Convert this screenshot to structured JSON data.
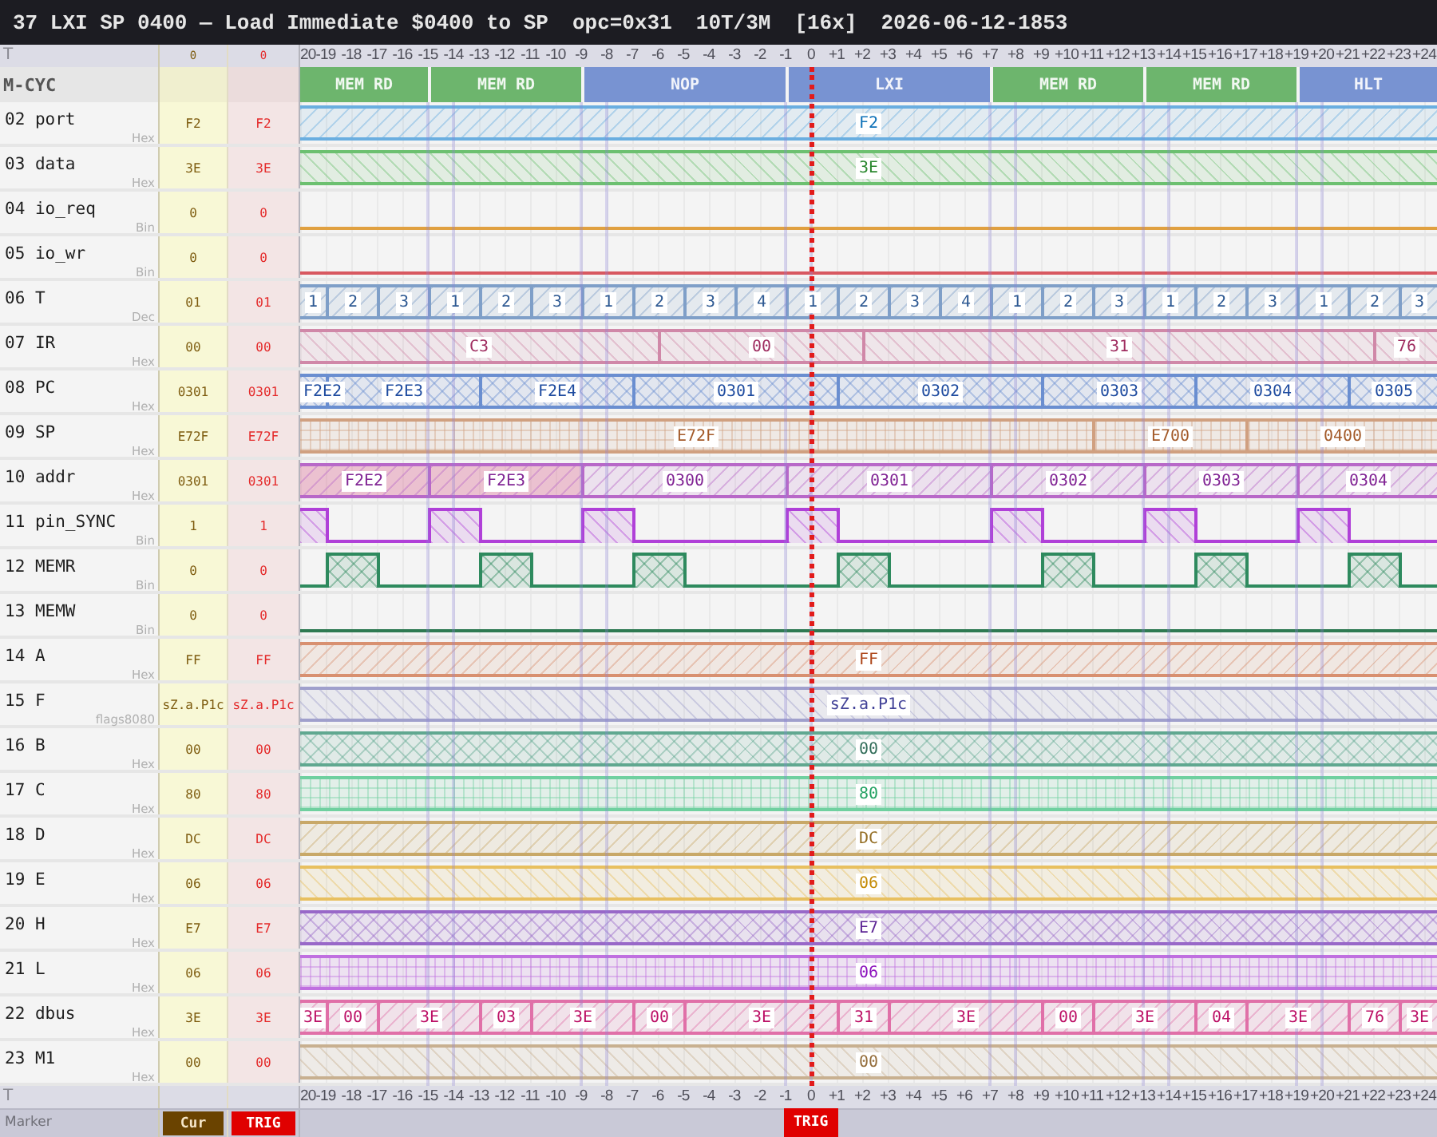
{
  "title_bar": {
    "parts": [
      "37 LXI SP 0400 — Load Immediate $0400 to SP",
      "opc=0x31",
      "10T/3M",
      "[16x]",
      "2026-06-12-1853"
    ]
  },
  "axis_top": {
    "label": "T",
    "cursor_value": "0",
    "trigger_value": "0",
    "ticks": [
      "20",
      "-19",
      "-18",
      "-17",
      "-16",
      "-15",
      "-14",
      "-13",
      "-12",
      "-11",
      "-10",
      "-9",
      "-8",
      "-7",
      "-6",
      "-5",
      "-4",
      "-3",
      "-2",
      "-1",
      "0",
      "+1",
      "+2",
      "+3",
      "+4",
      "+5",
      "+6",
      "+7",
      "+8",
      "+9",
      "+10",
      "+11",
      "+12",
      "+13",
      "+14",
      "+15",
      "+16",
      "+17",
      "+18",
      "+19",
      "+20",
      "+21",
      "+22",
      "+23",
      "+24"
    ]
  },
  "machine_cycles": {
    "label": "M-CYC",
    "cycles": [
      {
        "name": "MEM RD",
        "color": "#6db56d"
      },
      {
        "name": "MEM RD",
        "color": "#6db56d"
      },
      {
        "name": "NOP",
        "color": "#7893d2"
      },
      {
        "name": "LXI",
        "color": "#7893d2"
      },
      {
        "name": "MEM RD",
        "color": "#6db56d"
      },
      {
        "name": "MEM RD",
        "color": "#6db56d"
      },
      {
        "name": "HLT",
        "color": "#7893d2"
      }
    ]
  },
  "signals": [
    {
      "label": "02 port",
      "format": "Hex",
      "cursor_value": "F2",
      "trigger_value": "F2",
      "kind": "bus",
      "color": "#6aaee0",
      "segments": [
        {
          "value": "F2"
        }
      ]
    },
    {
      "label": "03 data",
      "format": "Hex",
      "cursor_value": "3E",
      "trigger_value": "3E",
      "kind": "bus",
      "color": "#6cc070",
      "segments": [
        {
          "value": "3E"
        }
      ]
    },
    {
      "label": "04 io_req",
      "format": "Bin",
      "cursor_value": "0",
      "trigger_value": "0",
      "kind": "bit",
      "color": "#e0a040",
      "segments": [
        {
          "high": false
        }
      ]
    },
    {
      "label": "05 io_wr",
      "format": "Bin",
      "cursor_value": "0",
      "trigger_value": "0",
      "kind": "bit",
      "color": "#d85860",
      "segments": [
        {
          "high": false
        }
      ]
    },
    {
      "label": "06 T",
      "format": "Dec",
      "cursor_value": "01",
      "trigger_value": "01",
      "kind": "bus",
      "color": "#7f9fc8",
      "segments": [
        {
          "value": "1"
        },
        {
          "value": "2"
        },
        {
          "value": "3"
        },
        {
          "value": "1"
        },
        {
          "value": "2"
        },
        {
          "value": "3"
        },
        {
          "value": "1"
        },
        {
          "value": "2"
        },
        {
          "value": "3"
        },
        {
          "value": "4"
        },
        {
          "value": "1"
        },
        {
          "value": "2"
        },
        {
          "value": "3"
        },
        {
          "value": "4"
        },
        {
          "value": "1"
        },
        {
          "value": "2"
        },
        {
          "value": "3"
        },
        {
          "value": "1"
        },
        {
          "value": "2"
        },
        {
          "value": "3"
        },
        {
          "value": "1"
        },
        {
          "value": "2"
        },
        {
          "value": "3"
        }
      ]
    },
    {
      "label": "07 IR",
      "format": "Hex",
      "cursor_value": "00",
      "trigger_value": "00",
      "kind": "bus",
      "color": "#d088a8",
      "segments": [
        {
          "value": "C3"
        },
        {
          "value": "00"
        },
        {
          "value": "31"
        },
        {
          "value": "76"
        }
      ]
    },
    {
      "label": "08 PC",
      "format": "Hex",
      "cursor_value": "0301",
      "trigger_value": "0301",
      "kind": "bus",
      "color": "#6a8ed0",
      "segments": [
        {
          "value": "F2E2"
        },
        {
          "value": "F2E3"
        },
        {
          "value": "F2E4"
        },
        {
          "value": "0301"
        },
        {
          "value": "0302"
        },
        {
          "value": "0303"
        },
        {
          "value": "0304"
        },
        {
          "value": "0305"
        }
      ]
    },
    {
      "label": "09 SP",
      "format": "Hex",
      "cursor_value": "E72F",
      "trigger_value": "E72F",
      "kind": "bus",
      "color": "#d0a080",
      "segments": [
        {
          "value": "E72F"
        },
        {
          "value": "E700"
        },
        {
          "value": "0400"
        }
      ]
    },
    {
      "label": "10 addr",
      "format": "Hex",
      "cursor_value": "0301",
      "trigger_value": "0301",
      "kind": "bus",
      "color": "#b868c8",
      "segments": [
        {
          "value": "F2E2",
          "highlighted": true
        },
        {
          "value": "F2E3",
          "highlighted": true
        },
        {
          "value": "0300",
          "highlighted": false
        },
        {
          "value": "0301",
          "highlighted": false
        },
        {
          "value": "0302",
          "highlighted": false
        },
        {
          "value": "0303",
          "highlighted": false
        },
        {
          "value": "0304",
          "highlighted": false
        }
      ]
    },
    {
      "label": "11 pin_SYNC",
      "format": "Bin",
      "cursor_value": "1",
      "trigger_value": "1",
      "kind": "bit",
      "color": "#b040d8",
      "segments": [
        {
          "high": true
        },
        {
          "high": false
        },
        {
          "high": true
        },
        {
          "high": false
        },
        {
          "high": true
        },
        {
          "high": false
        },
        {
          "high": true
        },
        {
          "high": false
        },
        {
          "high": true
        },
        {
          "high": false
        },
        {
          "high": true
        },
        {
          "high": false
        },
        {
          "high": true
        },
        {
          "high": false
        }
      ]
    },
    {
      "label": "12 MEMR",
      "format": "Bin",
      "cursor_value": "0",
      "trigger_value": "0",
      "kind": "bit",
      "color": "#2e8a5e",
      "segments": [
        {
          "high": false
        },
        {
          "high": true
        },
        {
          "high": false
        },
        {
          "high": true
        },
        {
          "high": false
        },
        {
          "high": true
        },
        {
          "high": false
        },
        {
          "high": true
        },
        {
          "high": false
        },
        {
          "high": true
        },
        {
          "high": false
        },
        {
          "high": true
        },
        {
          "high": false
        },
        {
          "high": true
        },
        {
          "high": false
        }
      ]
    },
    {
      "label": "13 MEMW",
      "format": "Bin",
      "cursor_value": "0",
      "trigger_value": "0",
      "kind": "bit",
      "color": "#2e7a52",
      "segments": [
        {
          "high": false
        }
      ]
    },
    {
      "label": "14 A",
      "format": "Hex",
      "cursor_value": "FF",
      "trigger_value": "FF",
      "kind": "bus",
      "color": "#d89070",
      "segments": [
        {
          "value": "FF"
        }
      ]
    },
    {
      "label": "15 F",
      "format": "flags8080",
      "cursor_value": "sZ.a.P1c",
      "trigger_value": "sZ.a.P1c",
      "kind": "bus",
      "color": "#a0a0cc",
      "segments": [
        {
          "value": "sZ.a.P1c"
        }
      ]
    },
    {
      "label": "16 B",
      "format": "Hex",
      "cursor_value": "00",
      "trigger_value": "00",
      "kind": "bus",
      "color": "#60a890",
      "segments": [
        {
          "value": "00"
        }
      ]
    },
    {
      "label": "17 C",
      "format": "Hex",
      "cursor_value": "80",
      "trigger_value": "80",
      "kind": "bus",
      "color": "#70d0a0",
      "segments": [
        {
          "value": "80"
        }
      ]
    },
    {
      "label": "18 D",
      "format": "Hex",
      "cursor_value": "DC",
      "trigger_value": "DC",
      "kind": "bus",
      "color": "#c8a868",
      "segments": [
        {
          "value": "DC"
        }
      ]
    },
    {
      "label": "19 E",
      "format": "Hex",
      "cursor_value": "06",
      "trigger_value": "06",
      "kind": "bus",
      "color": "#e8c060",
      "segments": [
        {
          "value": "06"
        }
      ]
    },
    {
      "label": "20 H",
      "format": "Hex",
      "cursor_value": "E7",
      "trigger_value": "E7",
      "kind": "bus",
      "color": "#9868c8",
      "segments": [
        {
          "value": "E7"
        }
      ]
    },
    {
      "label": "21 L",
      "format": "Hex",
      "cursor_value": "06",
      "trigger_value": "06",
      "kind": "bus",
      "color": "#c070e0",
      "segments": [
        {
          "value": "06"
        }
      ]
    },
    {
      "label": "22 dbus",
      "format": "Hex",
      "cursor_value": "3E",
      "trigger_value": "3E",
      "kind": "bus",
      "color": "#e070a8",
      "segments": [
        {
          "value": "3E"
        },
        {
          "value": "00"
        },
        {
          "value": "3E"
        },
        {
          "value": "03"
        },
        {
          "value": "3E"
        },
        {
          "value": "00"
        },
        {
          "value": "3E"
        },
        {
          "value": "31"
        },
        {
          "value": "3E"
        },
        {
          "value": "00"
        },
        {
          "value": "3E"
        },
        {
          "value": "04"
        },
        {
          "value": "3E"
        },
        {
          "value": "76"
        },
        {
          "value": "3E"
        }
      ]
    },
    {
      "label": "23 M1",
      "format": "Hex",
      "cursor_value": "00",
      "trigger_value": "00",
      "kind": "bus",
      "color": "#c8b090",
      "segments": [
        {
          "value": "00"
        }
      ]
    }
  ],
  "axis_bottom": {
    "label": "T",
    "ticks": [
      "20",
      "-19",
      "-18",
      "-17",
      "-16",
      "-15",
      "-14",
      "-13",
      "-12",
      "-11",
      "-10",
      "-9",
      "-8",
      "-7",
      "-6",
      "-5",
      "-4",
      "-3",
      "-2",
      "-1",
      "0",
      "+1",
      "+2",
      "+3",
      "+4",
      "+5",
      "+6",
      "+7",
      "+8",
      "+9",
      "+10",
      "+11",
      "+12",
      "+13",
      "+14",
      "+15",
      "+16",
      "+17",
      "+18",
      "+19",
      "+20",
      "+21",
      "+22",
      "+23",
      "+24"
    ]
  },
  "marker_bar": {
    "label": "Marker",
    "cursor_tag": "Cur",
    "trigger_tag": "TRIG",
    "timeline_tags": [
      {
        "label": "TRIG"
      }
    ]
  }
}
